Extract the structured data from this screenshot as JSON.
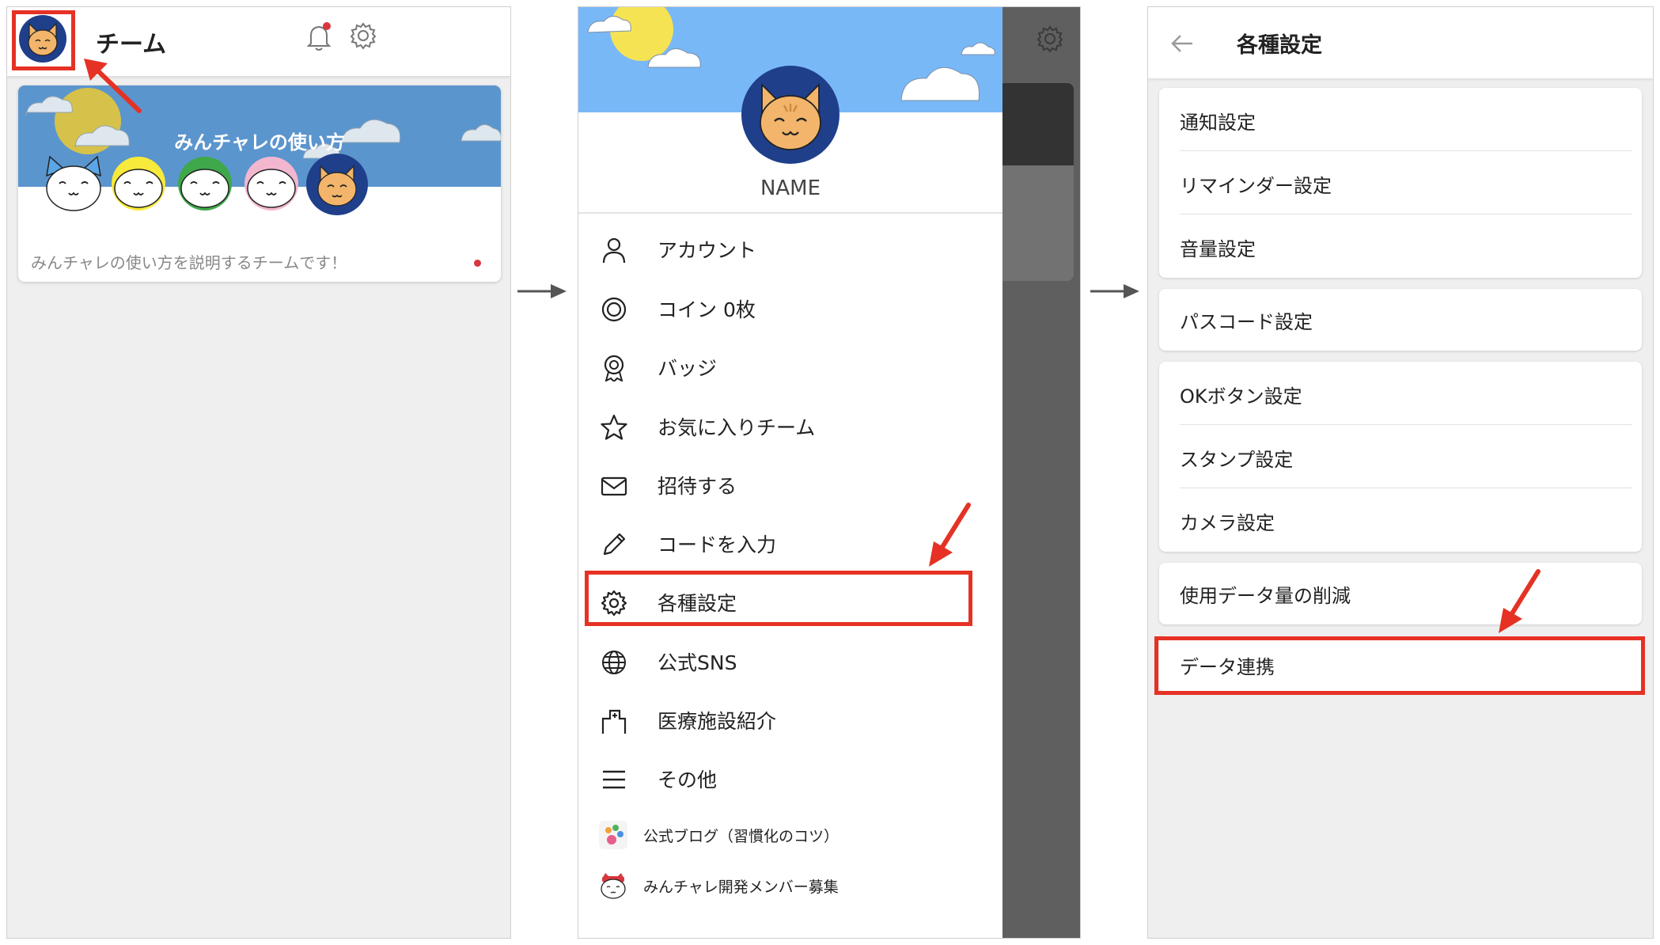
{
  "screen1": {
    "header_title": "チーム",
    "banner_title": "みんチャレの使い方",
    "team_description": "みんチャレの使い方を説明するチームです！"
  },
  "screen2": {
    "profile_name": "NAME",
    "menu": [
      {
        "icon": "person-icon",
        "label": "アカウント"
      },
      {
        "icon": "coin-icon",
        "label": "コイン 0枚"
      },
      {
        "icon": "badge-icon",
        "label": "バッジ"
      },
      {
        "icon": "star-icon",
        "label": "お気に入りチーム"
      },
      {
        "icon": "envelope-icon",
        "label": "招待する"
      },
      {
        "icon": "pencil-icon",
        "label": "コードを入力"
      },
      {
        "icon": "gear-icon",
        "label": "各種設定"
      },
      {
        "icon": "globe-icon",
        "label": "公式SNS"
      },
      {
        "icon": "hospital-icon",
        "label": "医療施設紹介"
      },
      {
        "icon": "hamburger-icon",
        "label": "その他"
      }
    ],
    "links": [
      {
        "icon": "paw-logo-icon",
        "label": "公式ブログ（習慣化のコツ）"
      },
      {
        "icon": "cat-recruit-icon",
        "label": "みんチャレ開発メンバー募集"
      }
    ]
  },
  "screen3": {
    "header_title": "各種設定",
    "groups": [
      [
        "通知設定",
        "リマインダー設定",
        "音量設定"
      ],
      [
        "パスコード設定"
      ],
      [
        "OKボタン設定",
        "スタンプ設定",
        "カメラ設定"
      ],
      [
        "使用データ量の削減"
      ],
      [
        "データ連携"
      ]
    ]
  },
  "colors": {
    "highlight_red": "#e53225",
    "notification_dot": "#d9363e",
    "banner_blue": "#5b95cd",
    "drawer_sky": "#79b8f7",
    "avatar_navy": "#1f3f8a",
    "cat_orange": "#f2b56b"
  }
}
